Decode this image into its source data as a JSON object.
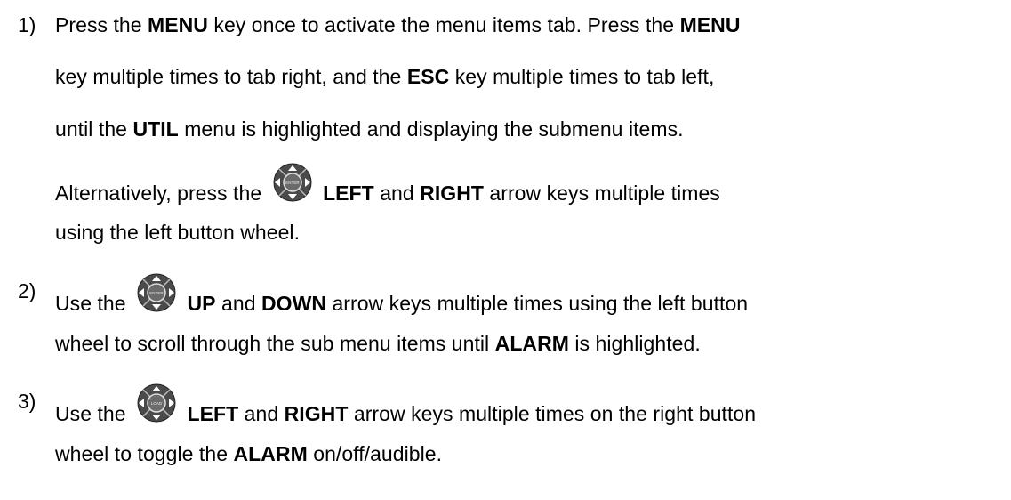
{
  "steps": [
    {
      "number": "1)",
      "lines": [
        [
          "Press the ",
          {
            "b": "MENU"
          },
          " key once to activate the menu items tab.  Press the ",
          {
            "b": "MENU"
          }
        ],
        [
          "key multiple times to tab right, and the ",
          {
            "b": "ESC"
          },
          " key multiple times to tab left,"
        ],
        [
          "until the ",
          {
            "b": "UTIL"
          },
          " menu is highlighted and displaying the submenu items."
        ],
        [
          "Alternatively, press the ",
          {
            "icon": "enter-wheel-icon"
          },
          " ",
          {
            "b": "LEFT"
          },
          " and ",
          {
            "b": "RIGHT"
          },
          " arrow keys multiple times"
        ],
        [
          "using the left button wheel."
        ]
      ]
    },
    {
      "number": "2)",
      "lines": [
        [
          "Use the ",
          {
            "icon": "enter-wheel-icon"
          },
          " ",
          {
            "b": "UP"
          },
          " and ",
          {
            "b": "DOWN"
          },
          " arrow keys multiple times using the left button"
        ],
        [
          "wheel to scroll through the sub menu items until ",
          {
            "b": "ALARM"
          },
          " is highlighted."
        ]
      ]
    },
    {
      "number": "3)",
      "lines": [
        [
          "Use the ",
          {
            "icon": "right-wheel-icon"
          },
          " ",
          {
            "b": "LEFT"
          },
          " and ",
          {
            "b": "RIGHT"
          },
          " arrow keys multiple times on the right button"
        ],
        [
          "wheel to toggle the ",
          {
            "b": "ALARM"
          },
          " on/off/audible."
        ]
      ]
    }
  ],
  "icons": {
    "enter-wheel-icon": {
      "center_label": "ENTER",
      "fill": "#4a4a4a",
      "arrow": "#ffffff"
    },
    "right-wheel-icon": {
      "center_label": "LOAD",
      "fill": "#4a4a4a",
      "arrow": "#ffffff"
    }
  }
}
